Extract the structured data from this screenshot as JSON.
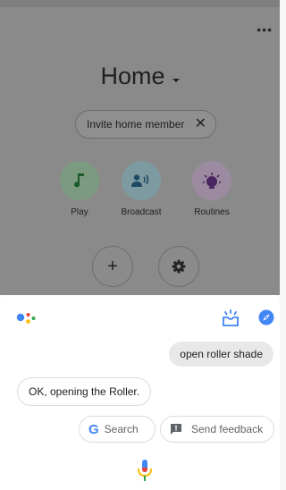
{
  "home": {
    "title": "Home",
    "invite_chip": {
      "label": "Invite home member",
      "close_glyph": "✕"
    },
    "actions": [
      {
        "label": "Play",
        "icon": "music-note-icon"
      },
      {
        "label": "Broadcast",
        "icon": "broadcast-icon"
      },
      {
        "label": "Routines",
        "icon": "routines-icon"
      }
    ],
    "more_glyph": "•••",
    "add_glyph": "+"
  },
  "assistant": {
    "user_query": "open roller shade",
    "reply": "OK, opening the Roller.",
    "suggestions": [
      {
        "label": "Search",
        "icon": "google-g-icon"
      },
      {
        "label": "Send feedback",
        "icon": "feedback-icon"
      }
    ],
    "google_glyph": "G"
  },
  "colors": {
    "assistant_blue": "#4285f4",
    "assistant_red": "#ea4335",
    "assistant_yellow": "#fbbc04",
    "assistant_green": "#34a853"
  }
}
